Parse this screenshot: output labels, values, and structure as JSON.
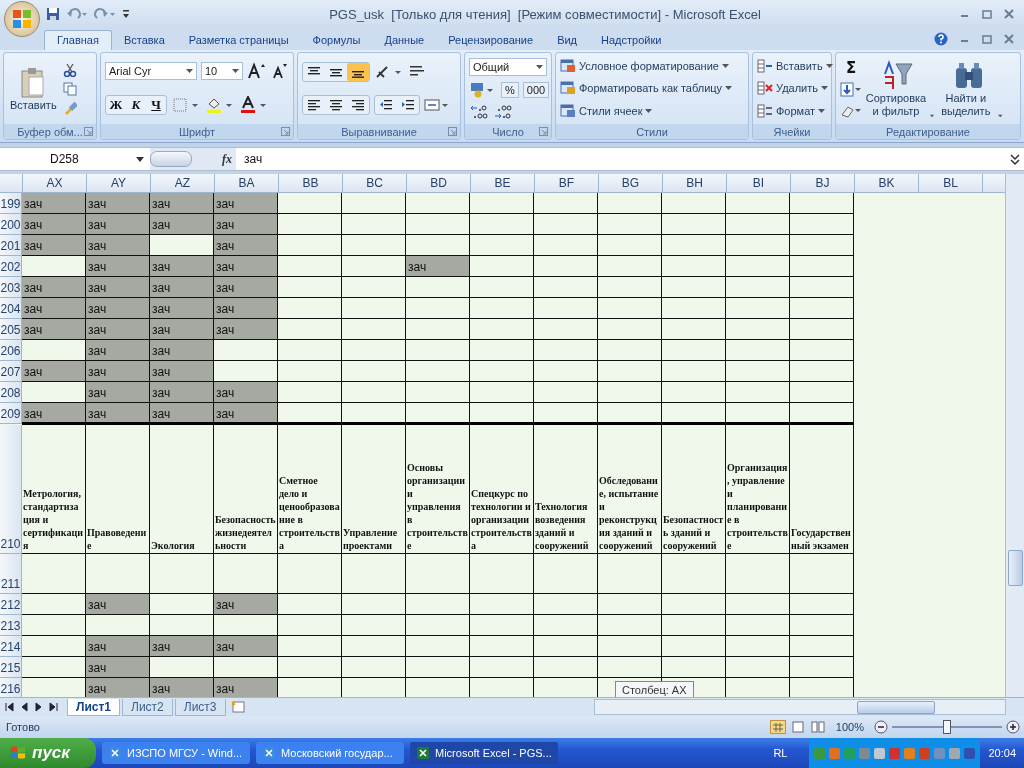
{
  "window": {
    "title": "PGS_usk  [Только для чтения]  [Режим совместимости] - Microsoft Excel"
  },
  "ribbon_tabs": [
    {
      "label": "Главная",
      "selected": true
    },
    {
      "label": "Вставка",
      "selected": false
    },
    {
      "label": "Разметка страницы",
      "selected": false
    },
    {
      "label": "Формулы",
      "selected": false
    },
    {
      "label": "Данные",
      "selected": false
    },
    {
      "label": "Рецензирование",
      "selected": false
    },
    {
      "label": "Вид",
      "selected": false
    },
    {
      "label": "Надстройки",
      "selected": false
    }
  ],
  "clipboard": {
    "label": "Буфер обм...",
    "paste": "Вставить"
  },
  "font": {
    "label": "Шрифт",
    "font_name": "Arial Cyr",
    "font_size": "10",
    "bold": "Ж",
    "italic": "К",
    "underline": "Ч"
  },
  "alignment": {
    "label": "Выравнивание",
    "vertical_align": [
      {
        "selected": false
      },
      {
        "selected": false
      },
      {
        "selected": true
      }
    ]
  },
  "number": {
    "label": "Число",
    "format": "Общий",
    "percent": "%",
    "thousands": "000"
  },
  "styles": {
    "label": "Стили",
    "items": [
      "Условное форматирование",
      "Форматировать как таблицу",
      "Стили ячеек"
    ]
  },
  "cells": {
    "label": "Ячейки",
    "items": [
      "Вставить",
      "Удалить",
      "Формат"
    ]
  },
  "editing": {
    "label": "Редактирование",
    "autosum": "Σ",
    "sort": "Сортировка и фильтр",
    "find": "Найти и выделить"
  },
  "formula_bar": {
    "name_box": "D258",
    "function_label": "fx",
    "value": "зач"
  },
  "sheet": {
    "columns": [
      "AX",
      "AY",
      "AZ",
      "BA",
      "BB",
      "BC",
      "BD",
      "BE",
      "BF",
      "BG",
      "BH",
      "BI",
      "BJ",
      "BK",
      "BL"
    ],
    "rows": [
      {
        "number": "199",
        "kind": "data",
        "cells": [
          {
            "text": "зач",
            "filled": true
          },
          {
            "text": "зач",
            "filled": true
          },
          {
            "text": "зач",
            "filled": true
          },
          {
            "text": "зач",
            "filled": true
          },
          {
            "filled": false
          },
          {
            "filled": false
          },
          {
            "filled": false
          },
          {
            "filled": false
          },
          {
            "filled": false
          },
          {
            "filled": false
          },
          {
            "filled": false
          },
          {
            "filled": false
          },
          {
            "filled": false
          }
        ]
      },
      {
        "number": "200",
        "kind": "data",
        "cells": [
          {
            "text": "зач",
            "filled": true
          },
          {
            "text": "зач",
            "filled": true
          },
          {
            "text": "зач",
            "filled": true
          },
          {
            "text": "зач",
            "filled": true
          },
          {
            "filled": false
          },
          {
            "filled": false
          },
          {
            "filled": false
          },
          {
            "filled": false
          },
          {
            "filled": false
          },
          {
            "filled": false
          },
          {
            "filled": false
          },
          {
            "filled": false
          },
          {
            "filled": false
          }
        ]
      },
      {
        "number": "201",
        "kind": "data",
        "cells": [
          {
            "text": "зач",
            "filled": true
          },
          {
            "text": "зач",
            "filled": true
          },
          {
            "filled": false
          },
          {
            "text": "зач",
            "filled": true
          },
          {
            "filled": false
          },
          {
            "filled": false
          },
          {
            "filled": false
          },
          {
            "filled": false
          },
          {
            "filled": false
          },
          {
            "filled": false
          },
          {
            "filled": false
          },
          {
            "filled": false
          },
          {
            "filled": false
          }
        ]
      },
      {
        "number": "202",
        "kind": "data",
        "cells": [
          {
            "filled": false
          },
          {
            "text": "зач",
            "filled": true
          },
          {
            "text": "зач",
            "filled": true
          },
          {
            "text": "зач",
            "filled": true
          },
          {
            "filled": false
          },
          {
            "filled": false
          },
          {
            "text": "зач",
            "filled": true
          },
          {
            "filled": false
          },
          {
            "filled": false
          },
          {
            "filled": false
          },
          {
            "filled": false
          },
          {
            "filled": false
          },
          {
            "filled": false
          }
        ]
      },
      {
        "number": "203",
        "kind": "data",
        "cells": [
          {
            "text": "зач",
            "filled": true
          },
          {
            "text": "зач",
            "filled": true
          },
          {
            "text": "зач",
            "filled": true
          },
          {
            "text": "зач",
            "filled": true
          },
          {
            "filled": false
          },
          {
            "filled": false
          },
          {
            "filled": false
          },
          {
            "filled": false
          },
          {
            "filled": false
          },
          {
            "filled": false
          },
          {
            "filled": false
          },
          {
            "filled": false
          },
          {
            "filled": false
          }
        ]
      },
      {
        "number": "204",
        "kind": "data",
        "cells": [
          {
            "text": "зач",
            "filled": true
          },
          {
            "text": "зач",
            "filled": true
          },
          {
            "text": "зач",
            "filled": true
          },
          {
            "text": "зач",
            "filled": true
          },
          {
            "filled": false
          },
          {
            "filled": false
          },
          {
            "filled": false
          },
          {
            "filled": false
          },
          {
            "filled": false
          },
          {
            "filled": false
          },
          {
            "filled": false
          },
          {
            "filled": false
          },
          {
            "filled": false
          }
        ]
      },
      {
        "number": "205",
        "kind": "data",
        "cells": [
          {
            "text": "зач",
            "filled": true
          },
          {
            "text": "зач",
            "filled": true
          },
          {
            "text": "зач",
            "filled": true
          },
          {
            "text": "зач",
            "filled": true
          },
          {
            "filled": false
          },
          {
            "filled": false
          },
          {
            "filled": false
          },
          {
            "filled": false
          },
          {
            "filled": false
          },
          {
            "filled": false
          },
          {
            "filled": false
          },
          {
            "filled": false
          },
          {
            "filled": false
          }
        ]
      },
      {
        "number": "206",
        "kind": "data",
        "cells": [
          {
            "filled": false
          },
          {
            "text": "зач",
            "filled": true
          },
          {
            "text": "зач",
            "filled": true
          },
          {
            "filled": false
          },
          {
            "filled": false
          },
          {
            "filled": false
          },
          {
            "filled": false
          },
          {
            "filled": false
          },
          {
            "filled": false
          },
          {
            "filled": false
          },
          {
            "filled": false
          },
          {
            "filled": false
          },
          {
            "filled": false
          }
        ]
      },
      {
        "number": "207",
        "kind": "data",
        "cells": [
          {
            "text": "зач",
            "filled": true
          },
          {
            "text": "зач",
            "filled": true
          },
          {
            "text": "зач",
            "filled": true
          },
          {
            "filled": false
          },
          {
            "filled": false
          },
          {
            "filled": false
          },
          {
            "filled": false
          },
          {
            "filled": false
          },
          {
            "filled": false
          },
          {
            "filled": false
          },
          {
            "filled": false
          },
          {
            "filled": false
          },
          {
            "filled": false
          }
        ]
      },
      {
        "number": "208",
        "kind": "data",
        "cells": [
          {
            "filled": false
          },
          {
            "text": "зач",
            "filled": true
          },
          {
            "text": "зач",
            "filled": true
          },
          {
            "text": "зач",
            "filled": true
          },
          {
            "filled": false
          },
          {
            "filled": false
          },
          {
            "filled": false
          },
          {
            "filled": false
          },
          {
            "filled": false
          },
          {
            "filled": false
          },
          {
            "filled": false
          },
          {
            "filled": false
          },
          {
            "filled": false
          }
        ]
      },
      {
        "number": "209",
        "kind": "data",
        "thick_border_below": true,
        "cells": [
          {
            "text": "зач",
            "filled": true
          },
          {
            "text": "зач",
            "filled": true
          },
          {
            "text": "зач",
            "filled": true
          },
          {
            "text": "зач",
            "filled": true
          },
          {
            "filled": false
          },
          {
            "filled": false
          },
          {
            "filled": false
          },
          {
            "filled": false
          },
          {
            "filled": false
          },
          {
            "filled": false
          },
          {
            "filled": false
          },
          {
            "filled": false
          },
          {
            "filled": false
          }
        ]
      },
      {
        "number": "210",
        "kind": "header",
        "cells": [
          {
            "text": "Метрология, стандартизация и сертификация",
            "filled": false
          },
          {
            "text": "Правоведение",
            "filled": false
          },
          {
            "text": "Экология",
            "filled": false
          },
          {
            "text": "Безопасность жизнедеятельности",
            "filled": false
          },
          {
            "text": "Сметное дело и ценообразование в строительства",
            "filled": false
          },
          {
            "text": "Управление проектами",
            "filled": false
          },
          {
            "text": "Основы организации и управления в строительстве",
            "filled": false
          },
          {
            "text": "Спецкурс по технологии и организации строительства",
            "filled": false
          },
          {
            "text": "Технология возведения зданий и сооружений",
            "filled": false
          },
          {
            "text": "Обследование, испытание и реконструкция зданий и сооружений",
            "filled": false
          },
          {
            "text": "Безопастность зданий и сооружений",
            "filled": false
          },
          {
            "text": "Организация, управление и планирование в строительстве",
            "filled": false
          },
          {
            "text": "Государственный экзамен",
            "filled": false
          }
        ]
      },
      {
        "number": "211",
        "kind": "tall",
        "cells": [
          {
            "filled": false
          },
          {
            "filled": false
          },
          {
            "filled": false
          },
          {
            "filled": false
          },
          {
            "filled": false
          },
          {
            "filled": false
          },
          {
            "filled": false
          },
          {
            "filled": false
          },
          {
            "filled": false
          },
          {
            "filled": false
          },
          {
            "filled": false
          },
          {
            "filled": false
          },
          {
            "filled": false
          }
        ]
      },
      {
        "number": "212",
        "kind": "data",
        "cells": [
          {
            "filled": false
          },
          {
            "text": "зач",
            "filled": true
          },
          {
            "filled": false
          },
          {
            "text": "зач",
            "filled": true
          },
          {
            "filled": false
          },
          {
            "filled": false
          },
          {
            "filled": false
          },
          {
            "filled": false
          },
          {
            "filled": false
          },
          {
            "filled": false
          },
          {
            "filled": false
          },
          {
            "filled": false
          },
          {
            "filled": false
          }
        ]
      },
      {
        "number": "213",
        "kind": "data",
        "cells": [
          {
            "filled": false
          },
          {
            "filled": false
          },
          {
            "filled": false
          },
          {
            "filled": false
          },
          {
            "filled": false
          },
          {
            "filled": false
          },
          {
            "filled": false
          },
          {
            "filled": false
          },
          {
            "filled": false
          },
          {
            "filled": false
          },
          {
            "filled": false
          },
          {
            "filled": false
          },
          {
            "filled": false
          }
        ]
      },
      {
        "number": "214",
        "kind": "data",
        "cells": [
          {
            "filled": false
          },
          {
            "text": "зач",
            "filled": true
          },
          {
            "text": "зач",
            "filled": true
          },
          {
            "text": "зач",
            "filled": true
          },
          {
            "filled": false
          },
          {
            "filled": false
          },
          {
            "filled": false
          },
          {
            "filled": false
          },
          {
            "filled": false
          },
          {
            "filled": false
          },
          {
            "filled": false
          },
          {
            "filled": false
          },
          {
            "filled": false
          }
        ]
      },
      {
        "number": "215",
        "kind": "data",
        "cells": [
          {
            "filled": false
          },
          {
            "text": "зач",
            "filled": true
          },
          {
            "filled": false
          },
          {
            "filled": false
          },
          {
            "filled": false
          },
          {
            "filled": false
          },
          {
            "filled": false
          },
          {
            "filled": false
          },
          {
            "filled": false
          },
          {
            "filled": false
          },
          {
            "filled": false
          },
          {
            "filled": false
          },
          {
            "filled": false
          }
        ]
      },
      {
        "number": "216",
        "kind": "data",
        "cells": [
          {
            "filled": false
          },
          {
            "text": "зач",
            "filled": true
          },
          {
            "text": "зач",
            "filled": true
          },
          {
            "text": "зач",
            "filled": true
          },
          {
            "filled": false
          },
          {
            "filled": false
          },
          {
            "filled": false
          },
          {
            "filled": false
          },
          {
            "filled": false
          },
          {
            "filled": false
          },
          {
            "filled": false
          },
          {
            "filled": false
          },
          {
            "filled": false
          }
        ]
      }
    ]
  },
  "tooltip": "Столбец: AX",
  "sheet_tabs": [
    {
      "label": "Лист1",
      "selected": true
    },
    {
      "label": "Лист2",
      "selected": false
    },
    {
      "label": "Лист3",
      "selected": false
    }
  ],
  "status_bar": {
    "status": "Готово",
    "zoom": "100%",
    "zoom_slider": {
      "level": 0.5
    }
  },
  "taskbar": {
    "start": "пуск",
    "items": [
      {
        "label": "ИЗСПО МГСУ - Wind...",
        "selected": false
      },
      {
        "label": "Московский государ...",
        "selected": false
      },
      {
        "label": "Microsoft Excel - PGS...",
        "selected": true
      }
    ],
    "language": "RL",
    "clock": "20:04"
  }
}
